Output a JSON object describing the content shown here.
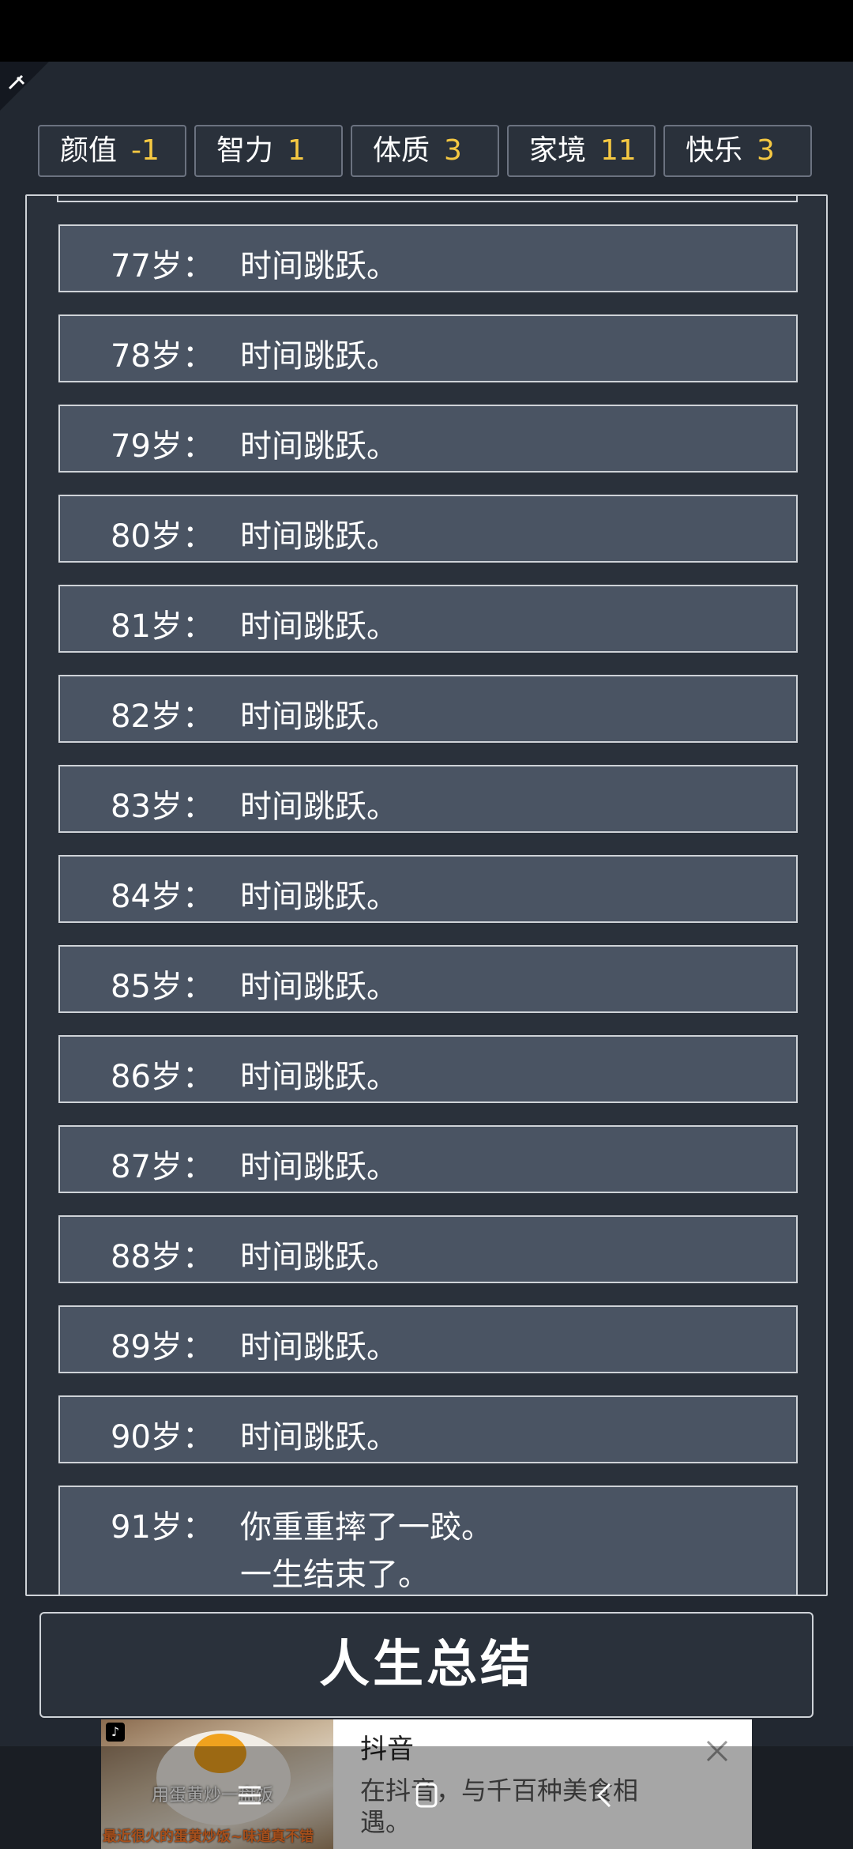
{
  "stats": [
    {
      "name": "颜值",
      "value": "-1"
    },
    {
      "name": "智力",
      "value": "1"
    },
    {
      "name": "体质",
      "value": "3"
    },
    {
      "name": "家境",
      "value": "11"
    },
    {
      "name": "快乐",
      "value": "3"
    }
  ],
  "log": [
    {
      "age": "77岁：",
      "event": "时间跳跃。"
    },
    {
      "age": "78岁：",
      "event": "时间跳跃。"
    },
    {
      "age": "79岁：",
      "event": "时间跳跃。"
    },
    {
      "age": "80岁：",
      "event": "时间跳跃。"
    },
    {
      "age": "81岁：",
      "event": "时间跳跃。"
    },
    {
      "age": "82岁：",
      "event": "时间跳跃。"
    },
    {
      "age": "83岁：",
      "event": "时间跳跃。"
    },
    {
      "age": "84岁：",
      "event": "时间跳跃。"
    },
    {
      "age": "85岁：",
      "event": "时间跳跃。"
    },
    {
      "age": "86岁：",
      "event": "时间跳跃。"
    },
    {
      "age": "87岁：",
      "event": "时间跳跃。"
    },
    {
      "age": "88岁：",
      "event": "时间跳跃。"
    },
    {
      "age": "89岁：",
      "event": "时间跳跃。"
    },
    {
      "age": "90岁：",
      "event": "时间跳跃。"
    },
    {
      "age": "91岁：",
      "event": "你重重摔了一跤。",
      "event2": "一生结束了。"
    }
  ],
  "summary_button": "人生总结",
  "ad": {
    "title": "抖音",
    "description": "在抖音，与千百种美食相遇。",
    "image_caption": "用蛋黄炒一盘饭",
    "image_banner": "最近很火的蛋黄炒饭~味道真不错",
    "close_icon": "close-icon"
  },
  "colors": {
    "background": "#222831",
    "row_fill": "#4a5463",
    "stat_value": "#f5c842",
    "border": "#cfd3d8"
  }
}
